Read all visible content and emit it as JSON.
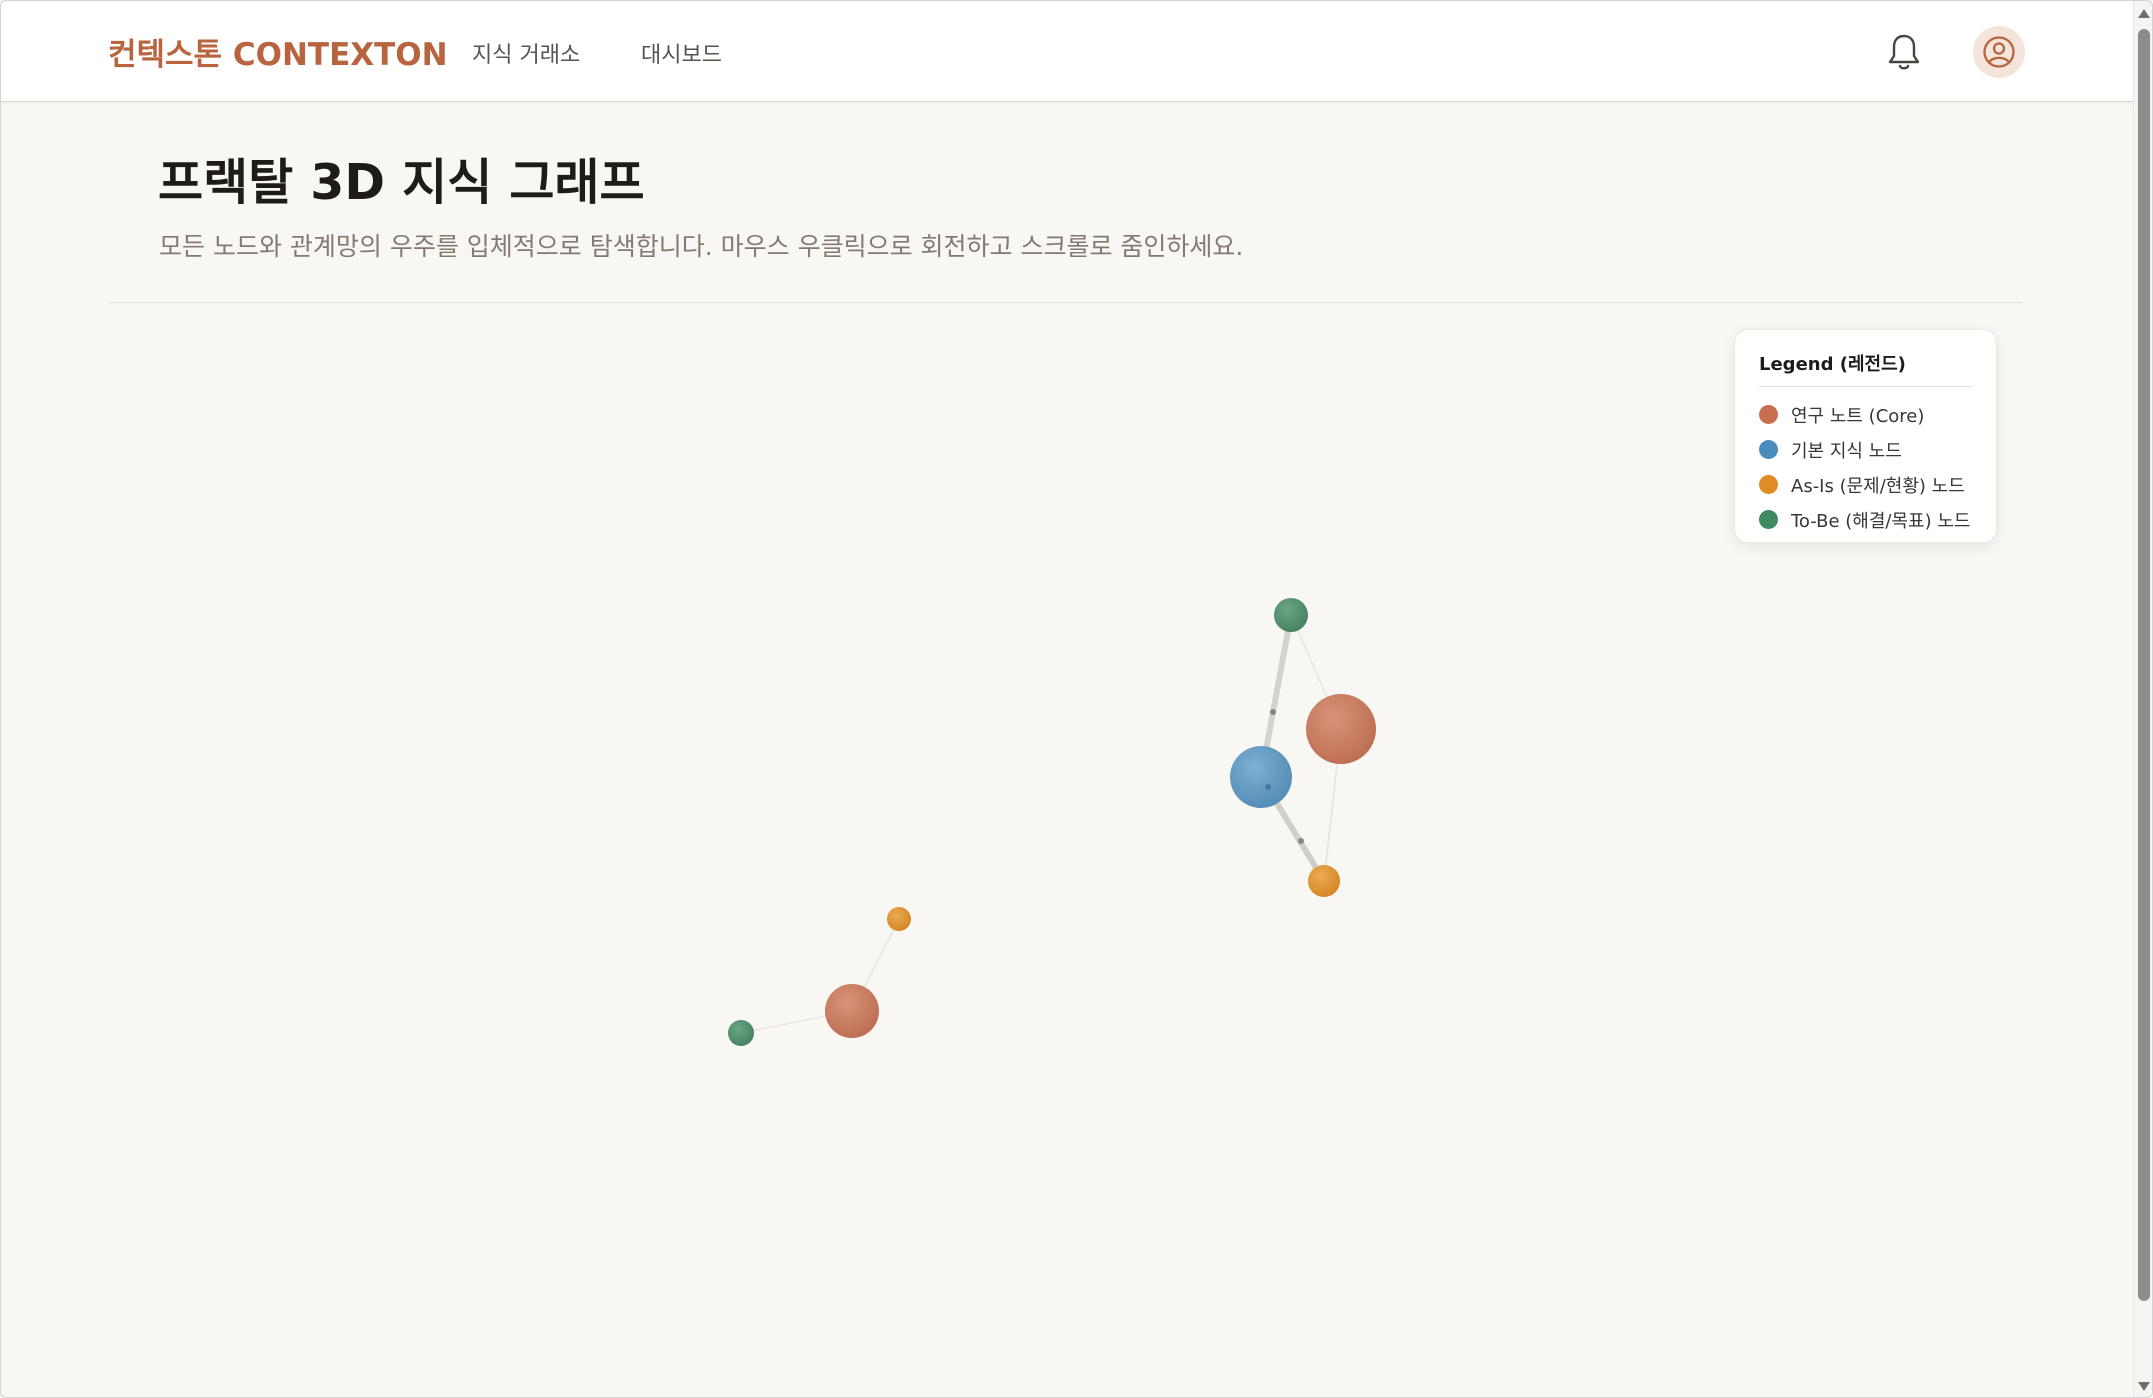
{
  "header": {
    "logo": "컨텍스톤 CONTEXTON",
    "nav": [
      "지식 거래소",
      "대시보드"
    ],
    "icons": {
      "notifications": "bell-icon",
      "profile": "user-circle-icon"
    }
  },
  "page": {
    "title": "프랙탈 3D 지식 그래프",
    "subtitle": "모든 노드와 관계망의 우주를 입체적으로 탐색합니다. 마우스 우클릭으로 회전하고 스크롤로 줌인하세요."
  },
  "legend": {
    "title": "Legend (레전드)",
    "items": [
      {
        "label": "연구 노트 (Core)",
        "color": "#c96f4f"
      },
      {
        "label": "기본 지식 노드",
        "color": "#4c8cbc"
      },
      {
        "label": "As-Is (문제/현황) 노드",
        "color": "#e08b25"
      },
      {
        "label": "To-Be (해결/목표) 노드",
        "color": "#3f8a63"
      }
    ]
  },
  "graph": {
    "node_types": [
      "core",
      "base",
      "as-is",
      "to-be"
    ],
    "colors": {
      "core": "#c97a5e",
      "base": "#5f98c2",
      "as-is": "#dc8e30",
      "to-be": "#4e8c6a"
    }
  }
}
